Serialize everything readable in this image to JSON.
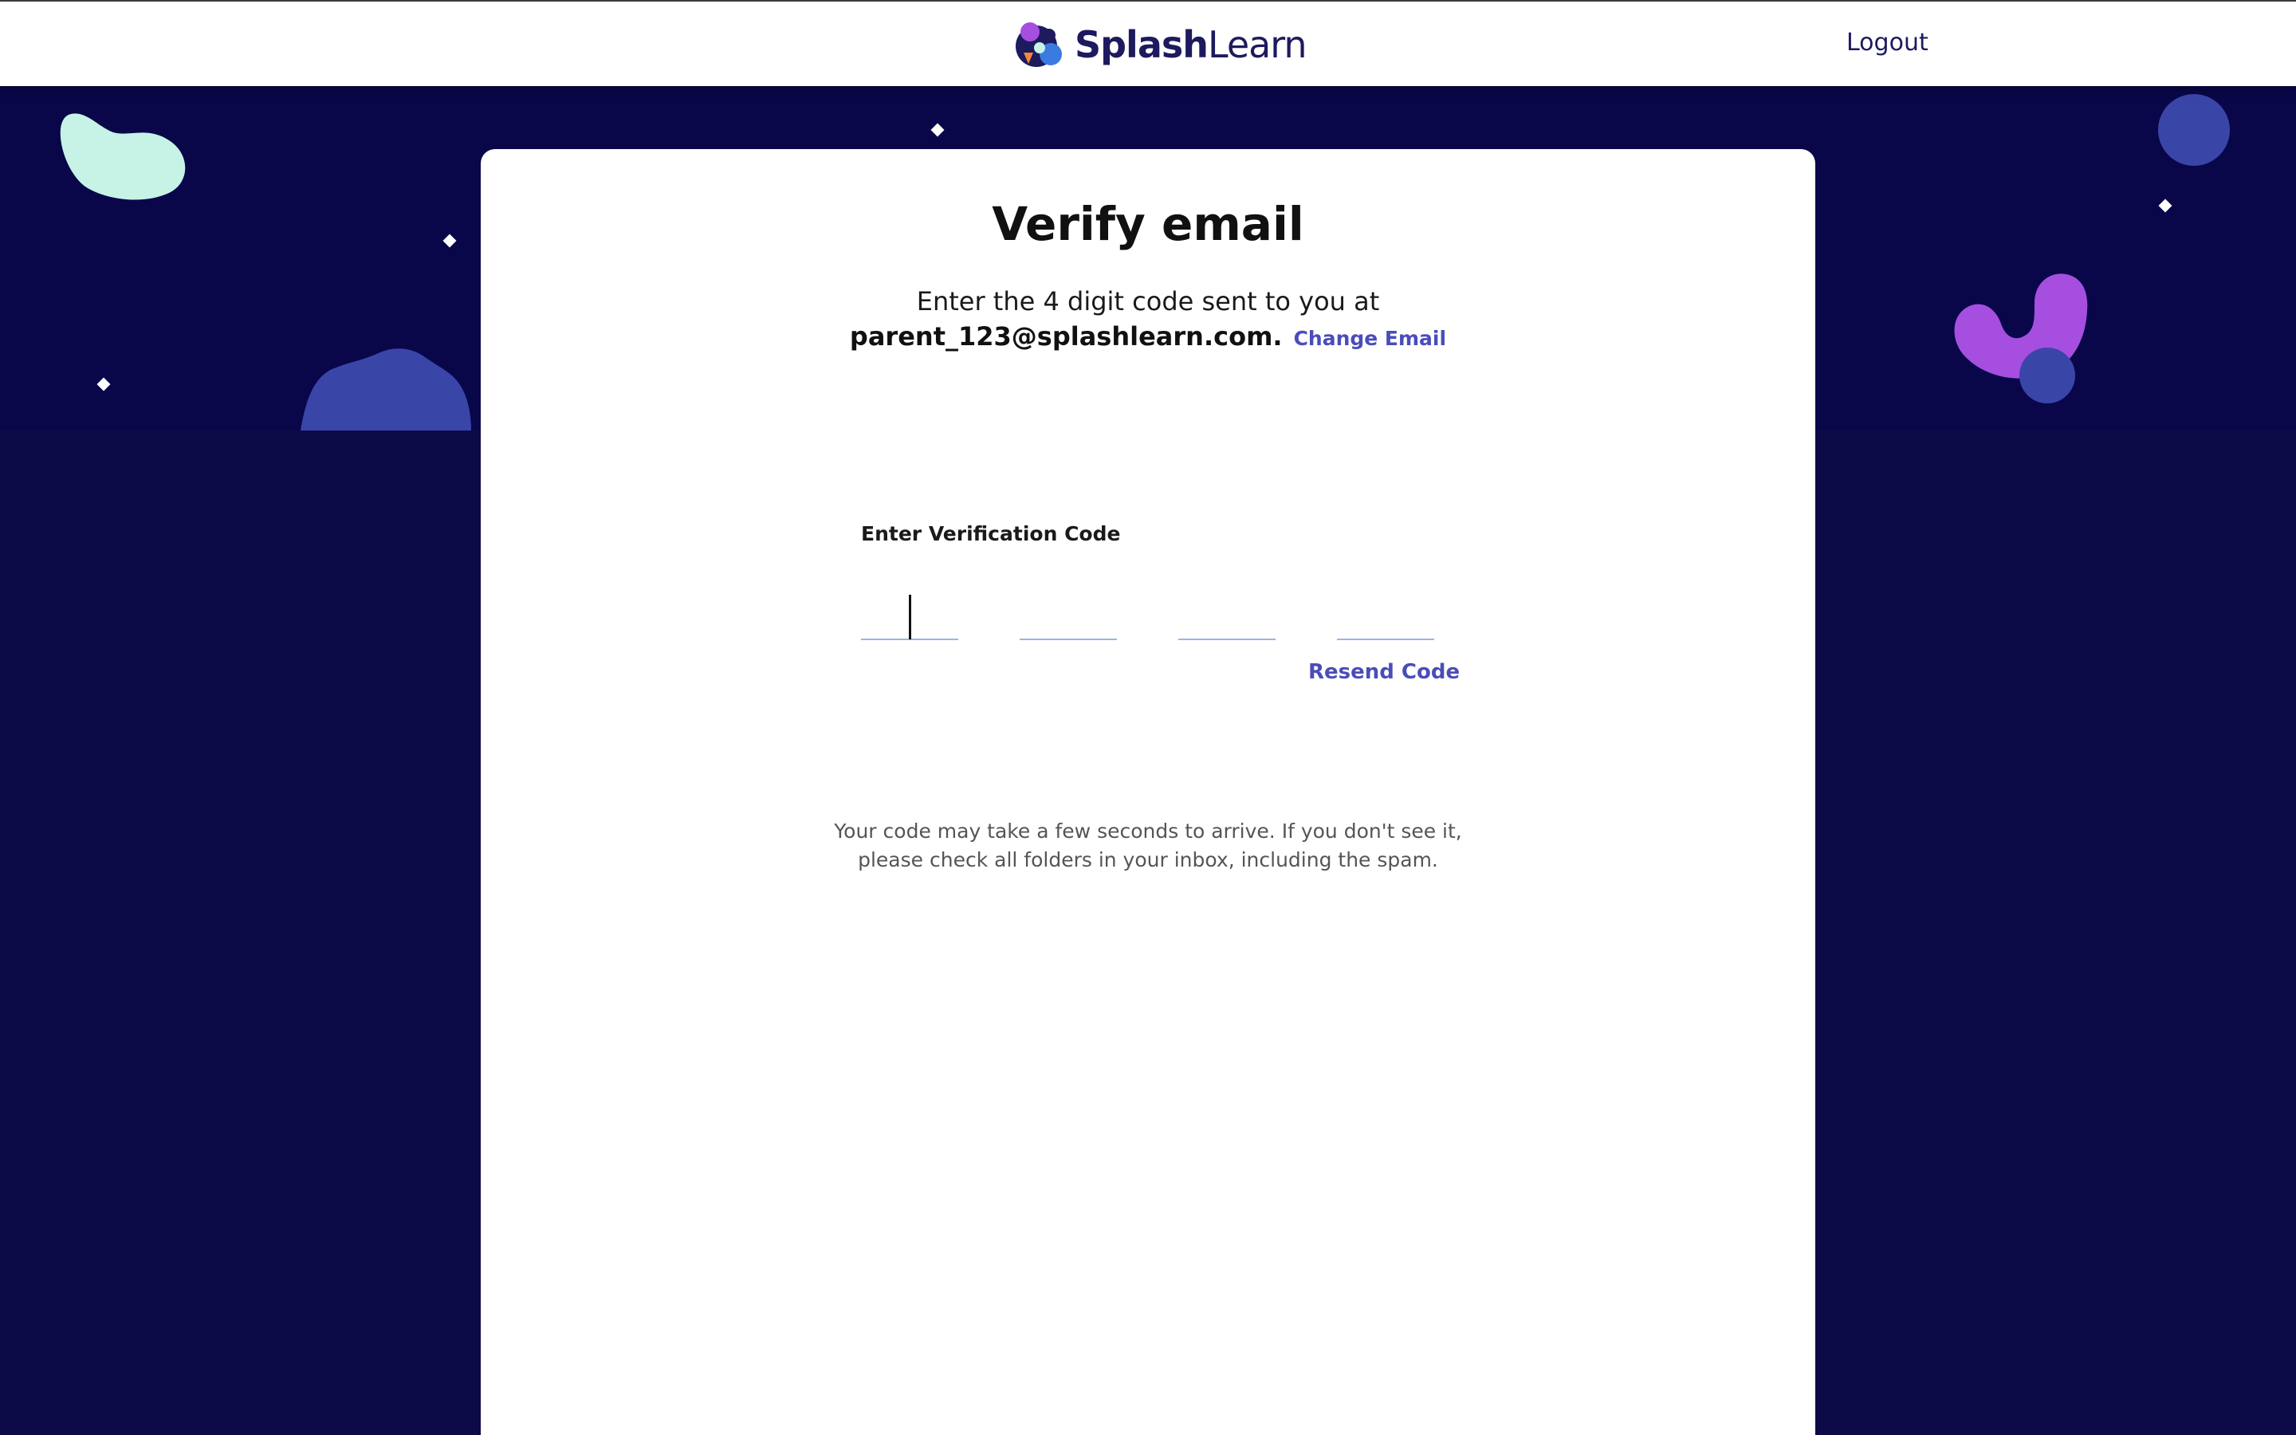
{
  "header": {
    "logo_bold": "Splash",
    "logo_light": "Learn",
    "logout_label": "Logout"
  },
  "card": {
    "title": "Verify email",
    "subtitle": "Enter the 4 digit code sent to you at",
    "email": "parent_123@splashlearn.com.",
    "change_email_label": "Change Email",
    "code_label": "Enter Verification Code",
    "code_digits": [
      "",
      "",
      "",
      ""
    ],
    "resend_label": "Resend Code",
    "help_text": "Your code may take a few seconds to arrive. If you don't see it, please check all folders in your inbox, including the spam."
  },
  "colors": {
    "background": "#0c0a47",
    "accent_link": "#4a4db8",
    "header_text": "#1d1a5e",
    "mint_blob": "#c6f3e6",
    "blue_blob": "#3a45a8",
    "purple_blob": "#a64ee0"
  }
}
